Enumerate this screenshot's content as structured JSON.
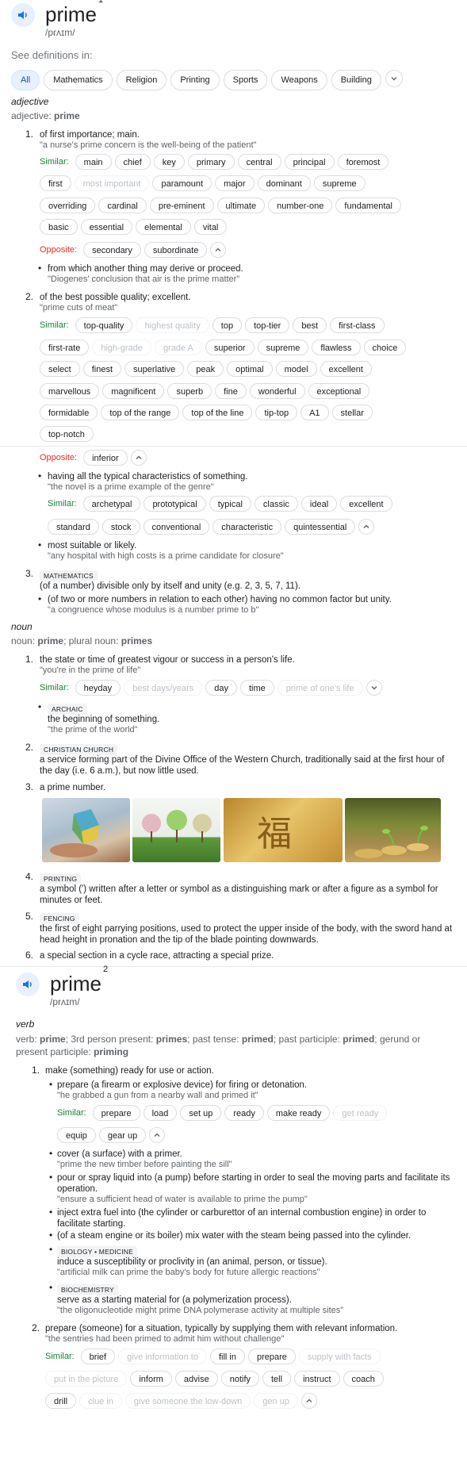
{
  "entry1": {
    "word": "prime",
    "sup": "1",
    "pron": "/prʌɪm/",
    "see_definitions": "See definitions in:",
    "filters": [
      "All",
      "Mathematics",
      "Religion",
      "Printing",
      "Sports",
      "Weapons",
      "Building"
    ],
    "adj": {
      "pos": "adjective",
      "forms_label": "adjective:",
      "forms_word": "prime",
      "s1": {
        "num": "1.",
        "def": "of first importance; main.",
        "ex": "\"a nurse's prime concern is the well-being of the patient\"",
        "similar_label": "Similar:",
        "similar": [
          "main",
          "chief",
          "key",
          "primary",
          "central",
          "principal",
          "foremost",
          "first",
          "most important",
          "paramount",
          "major",
          "dominant",
          "supreme",
          "overriding",
          "cardinal",
          "pre-eminent",
          "ultimate",
          "number-one",
          "fundamental",
          "basic",
          "essential",
          "elemental",
          "vital"
        ],
        "opposite_label": "Opposite:",
        "opposite": [
          "secondary",
          "subordinate"
        ],
        "sub_def": "from which another thing may derive or proceed.",
        "sub_ex": "\"Diogenes' conclusion that air is the prime matter\""
      },
      "s2": {
        "num": "2.",
        "def": "of the best possible quality; excellent.",
        "ex": "\"prime cuts of meat\"",
        "similar_label": "Similar:",
        "similar": [
          "top-quality",
          "highest quality",
          "top",
          "top-tier",
          "best",
          "first-class",
          "first-rate",
          "high-grade",
          "grade A",
          "superior",
          "supreme",
          "flawless",
          "choice",
          "select",
          "finest",
          "superlative",
          "peak",
          "optimal",
          "model",
          "excellent",
          "marvellous",
          "magnificent",
          "superb",
          "fine",
          "wonderful",
          "exceptional",
          "formidable",
          "top of the range",
          "top of the line",
          "tip-top",
          "A1",
          "stellar",
          "top-notch"
        ],
        "opposite_label": "Opposite:",
        "opposite": [
          "inferior"
        ],
        "sub1_def": "having all the typical characteristics of something.",
        "sub1_ex": "\"the novel is a prime example of the genre\"",
        "sub1_similar_label": "Similar:",
        "sub1_similar": [
          "archetypal",
          "prototypical",
          "typical",
          "classic",
          "ideal",
          "excellent",
          "standard",
          "stock",
          "conventional",
          "characteristic",
          "quintessential"
        ],
        "sub2_def": "most suitable or likely.",
        "sub2_ex": "\"any hospital with high costs is a prime candidate for closure\""
      },
      "s3": {
        "num": "3.",
        "tag": "MATHEMATICS",
        "def": "(of a number) divisible only by itself and unity (e.g. 2, 3, 5, 7, 11).",
        "sub_def": "(of two or more numbers in relation to each other) having no common factor but unity.",
        "sub_ex": "\"a congruence whose modulus is a number prime to b\""
      }
    },
    "noun": {
      "pos": "noun",
      "forms_label": "noun:",
      "forms_word": "prime",
      "forms_mid": "; plural noun:",
      "forms_plural": "primes",
      "s1": {
        "num": "1.",
        "def": "the state or time of greatest vigour or success in a person's life.",
        "ex": "\"you're in the prime of life\"",
        "similar_label": "Similar:",
        "similar": [
          "heyday",
          "best days/years",
          "day",
          "time",
          "prime of one's life"
        ],
        "sub_tag": "ARCHAIC",
        "sub_def": "the beginning of something.",
        "sub_ex": "\"the prime of the world\""
      },
      "s2": {
        "num": "2.",
        "tag": "CHRISTIAN CHURCH",
        "def": "a service forming part of the Divine Office of the Western Church, traditionally said at the first hour of the day (i.e. 6 a.m.), but now little used."
      },
      "s3": {
        "num": "3.",
        "def": "a prime number."
      },
      "s4": {
        "num": "4.",
        "tag": "PRINTING",
        "def": "a symbol (′) written after a letter or symbol as a distinguishing mark or after a figure as a symbol for minutes or feet."
      },
      "s5": {
        "num": "5.",
        "tag": "FENCING",
        "def": "the first of eight parrying positions, used to protect the upper inside of the body, with the sword hand at head height in pronation and the tip of the blade pointing downwards."
      },
      "s6": {
        "num": "6.",
        "def": "a special section in a cycle race, attracting a special prize."
      }
    }
  },
  "entry2": {
    "word": "prime",
    "sup": "2",
    "pron": "/prʌɪm/",
    "verb": {
      "pos": "verb",
      "forms": {
        "l1": "verb:",
        "w1": "prime",
        "l2": "; 3rd person present:",
        "w2": "primes",
        "l3": "; past tense:",
        "w3": "primed",
        "l4": "; past participle:",
        "w4": "primed",
        "l5": "; gerund or present participle:",
        "w5": "priming"
      },
      "s1": {
        "num": "1.",
        "def": "make (something) ready for use or action.",
        "a_def": "prepare (a firearm or explosive device) for firing or detonation.",
        "a_ex": "\"he grabbed a gun from a nearby wall and primed it\"",
        "a_similar_label": "Similar:",
        "a_similar": [
          "prepare",
          "load",
          "set up",
          "ready",
          "make ready",
          "get ready",
          "equip",
          "gear up"
        ],
        "b_def": "cover (a surface) with a primer.",
        "b_ex": "\"prime the new timber before painting the sill\"",
        "c_def": "pour or spray liquid into (a pump) before starting in order to seal the moving parts and facilitate its operation.",
        "c_ex": "\"ensure a sufficient head of water is available to prime the pump\"",
        "d_def": "inject extra fuel into (the cylinder or carburettor of an internal combustion engine) in order to facilitate starting.",
        "e_def": "(of a steam engine or its boiler) mix water with the steam being passed into the cylinder.",
        "f_tag": "BIOLOGY • MEDICINE",
        "f_def": "induce a susceptibility or proclivity in (an animal, person, or tissue).",
        "f_ex": "\"artificial milk can prime the baby's body for future allergic reactions\"",
        "g_tag": "BIOCHEMISTRY",
        "g_def": "serve as a starting material for (a polymerization process).",
        "g_ex": "\"the oligonucleotide might prime DNA polymerase activity at multiple sites\""
      },
      "s2": {
        "num": "2.",
        "def": "prepare (someone) for a situation, typically by supplying them with relevant information.",
        "ex": "\"the sentries had been primed to admit him without challenge\"",
        "similar_label": "Similar:",
        "similar": [
          "brief",
          "give information to",
          "fill in",
          "prepare",
          "supply with facts",
          "put in the picture",
          "inform",
          "advise",
          "notify",
          "tell",
          "instruct",
          "coach",
          "drill",
          "clue in",
          "give someone the low-down",
          "gen up"
        ]
      }
    }
  },
  "colors": {
    "accent": "#1a73e8",
    "similar": "#188038",
    "opposite": "#d93025",
    "muted": "#5f6368"
  },
  "icons": [
    "speaker-icon",
    "chevron-down-icon",
    "chevron-up-icon"
  ]
}
